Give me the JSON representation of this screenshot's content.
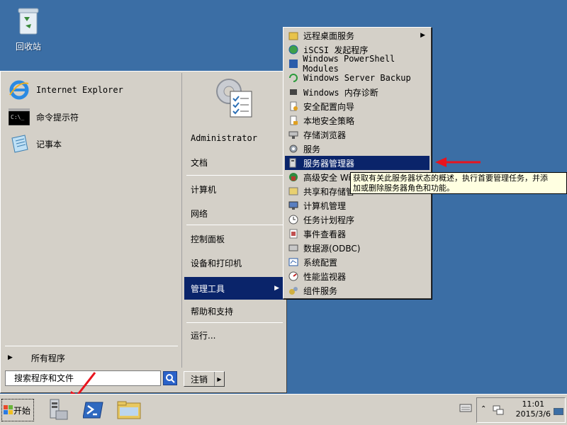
{
  "desktop": {
    "recycle_bin_label": "回收站"
  },
  "start_menu": {
    "programs": [
      {
        "label": "Internet Explorer",
        "icon": "ie-icon"
      },
      {
        "label": "命令提示符",
        "icon": "cmd-icon"
      },
      {
        "label": "记事本",
        "icon": "notepad-icon"
      }
    ],
    "all_programs": "所有程序",
    "search_placeholder": "搜索程序和文件",
    "user": "Administrator",
    "right_items": [
      "文档",
      "计算机",
      "网络",
      "控制面板",
      "设备和打印机",
      "管理工具",
      "帮助和支持",
      "运行..."
    ],
    "logout_label": "注销"
  },
  "admin_tools": {
    "items": [
      "远程桌面服务",
      "iSCSI 发起程序",
      "Windows PowerShell Modules",
      "Windows Server Backup",
      "Windows 内存诊断",
      "安全配置向导",
      "本地安全策略",
      "存储浏览器",
      "服务",
      "服务器管理器",
      "高级安全 Wi",
      "共享和存储管",
      "计算机管理",
      "任务计划程序",
      "事件查看器",
      "数据源(ODBC)",
      "系统配置",
      "性能监视器",
      "组件服务"
    ],
    "selected": "服务器管理器"
  },
  "tooltip": {
    "line1": "获取有关此服务器状态的概述，执行首要管理任务，并添",
    "line2": "加或删除服务器角色和功能。"
  },
  "taskbar": {
    "start_label": "开始",
    "time": "11:01",
    "date": "2015/3/6"
  },
  "colors": {
    "desktop": "#3b6ea5",
    "menu_bg": "#d4d0c8",
    "selection": "#0a246a",
    "tooltip_bg": "#ffffe1",
    "annotation_arrow": "#e8141e"
  }
}
